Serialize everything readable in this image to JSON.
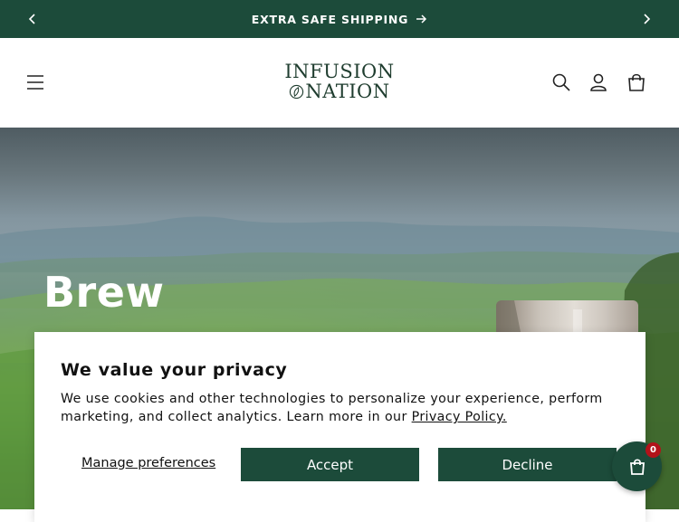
{
  "announcement": {
    "message": "EXTRA SAFE SHIPPING",
    "prev_icon": "chevron-left-icon",
    "next_icon": "chevron-right-icon",
    "arrow_icon": "arrow-right-icon"
  },
  "header": {
    "logo_line1": "INFUSION",
    "logo_line2": "NATION",
    "menu_icon": "hamburger-menu-icon",
    "icons": [
      "search-icon",
      "account-icon",
      "cart-icon"
    ]
  },
  "hero": {
    "title": "Brew"
  },
  "cookie_banner": {
    "heading": "We value your privacy",
    "body": "We use cookies and other technologies to personalize your experience, perform marketing, and collect analytics. Learn more in our",
    "policy_link": "Privacy Policy.",
    "manage_label": "Manage preferences",
    "accept_label": "Accept",
    "decline_label": "Decline"
  },
  "floating_cart": {
    "count": "0",
    "icon": "shopping-bag-icon"
  },
  "colors": {
    "brand_green": "#1c4b3a",
    "badge_red": "#b3121a"
  }
}
